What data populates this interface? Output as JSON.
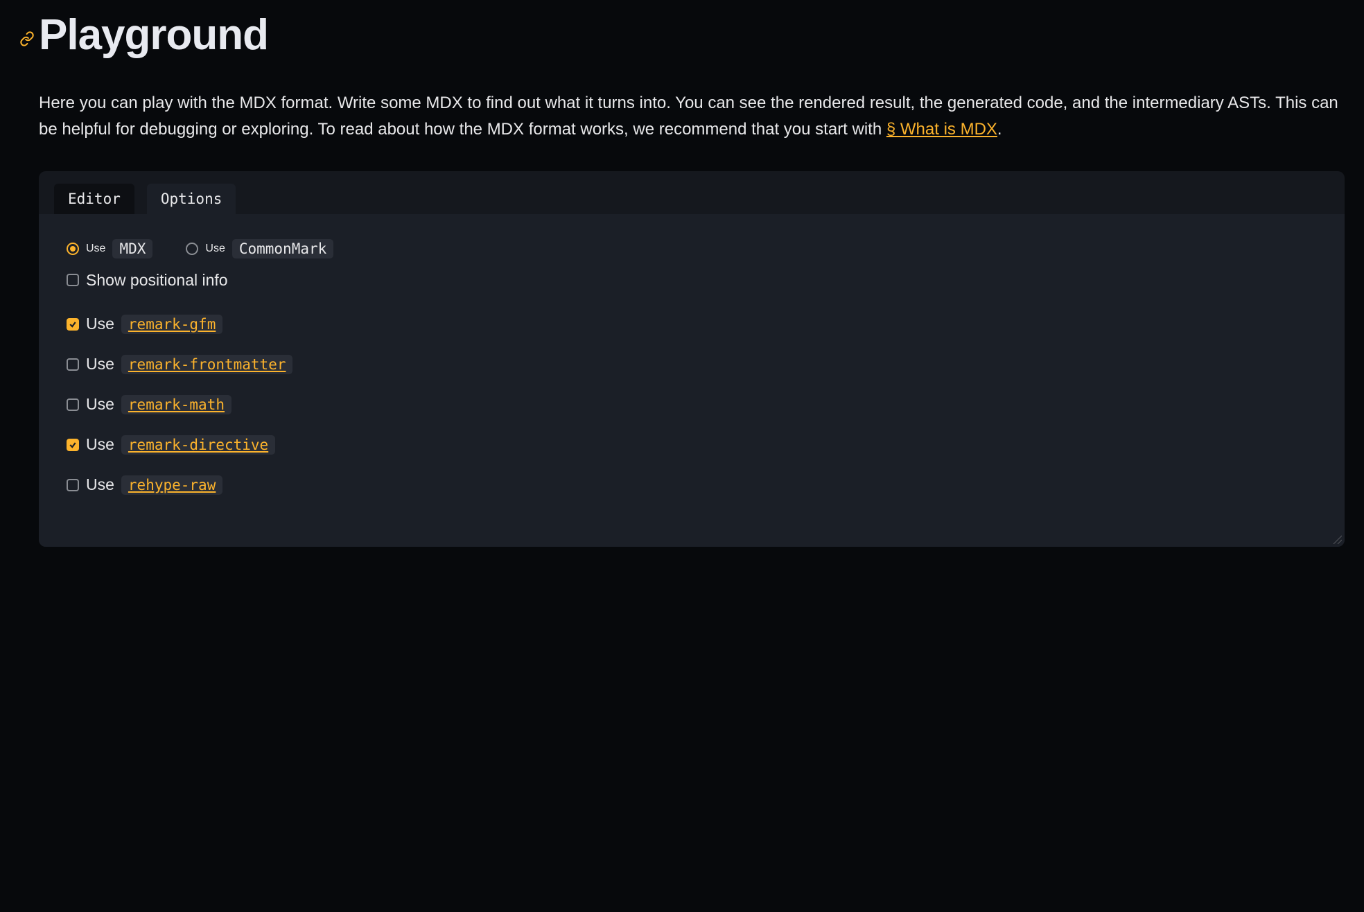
{
  "page": {
    "title": "Playground",
    "intro_part1": "Here you can play with the MDX format. Write some MDX to find out what it turns into. You can see the rendered result, the generated code, and the intermediary ASTs. This can be helpful for debugging or exploring. To read about how the MDX format works, we recommend that you start with ",
    "intro_link_text": "§ What is MDX",
    "intro_part2": "."
  },
  "tabs": {
    "editor": "Editor",
    "options": "Options",
    "active": "options"
  },
  "options": {
    "format": {
      "use_prefix": "Use ",
      "mdx": {
        "code": "MDX",
        "selected": true
      },
      "commonmark": {
        "code": "CommonMark",
        "selected": false
      }
    },
    "show_positional": {
      "label": "Show positional info",
      "checked": false
    },
    "plugins": [
      {
        "use_prefix": "Use ",
        "name": "remark-gfm",
        "checked": true
      },
      {
        "use_prefix": "Use ",
        "name": "remark-frontmatter",
        "checked": false
      },
      {
        "use_prefix": "Use ",
        "name": "remark-math",
        "checked": false
      },
      {
        "use_prefix": "Use ",
        "name": "remark-directive",
        "checked": true
      },
      {
        "use_prefix": "Use ",
        "name": "rehype-raw",
        "checked": false
      }
    ]
  }
}
